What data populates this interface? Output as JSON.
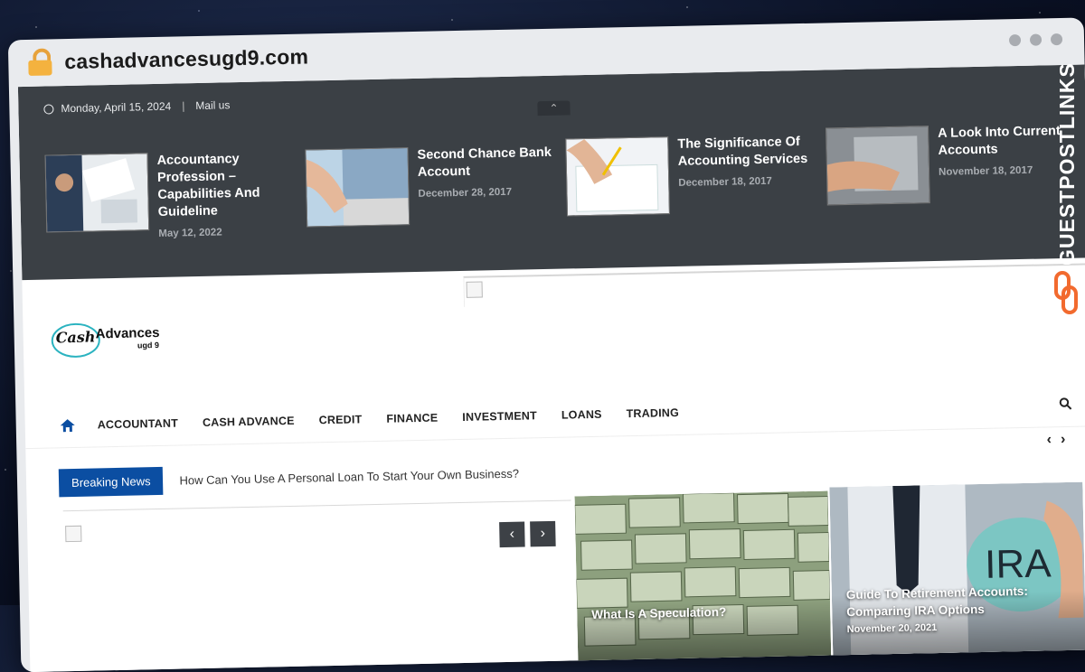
{
  "browser": {
    "url": "cashadvancesugd9.com"
  },
  "topbar": {
    "date": "Monday, April 15, 2024",
    "mail": "Mail us"
  },
  "top_slides": [
    {
      "title": "Accountancy Profession – Capabilities And Guideline",
      "date": "May 12, 2022"
    },
    {
      "title": "Second Chance Bank Account",
      "date": "December 28, 2017"
    },
    {
      "title": "The Significance Of Accounting Services",
      "date": "December 18, 2017"
    },
    {
      "title": "A Look Into Current Accounts",
      "date": "November 18, 2017"
    }
  ],
  "logo": {
    "main": "Cash Advances",
    "sub": "ugd 9"
  },
  "nav": {
    "items": [
      "ACCOUNTANT",
      "CASH ADVANCE",
      "CREDIT",
      "FINANCE",
      "INVESTMENT",
      "LOANS",
      "TRADING"
    ]
  },
  "breaking": {
    "label": "Breaking News",
    "headline": "How Can You Use A Personal Loan To Start Your Own Business?"
  },
  "cards": [
    {
      "title": "What Is A Speculation?",
      "date": ""
    },
    {
      "title": "Guide To Retirement Accounts: Comparing IRA Options",
      "date": "November 20, 2021"
    }
  ],
  "watermark": {
    "text": "GUESTPOSTLINKS"
  },
  "colors": {
    "topbar": "#3b4045",
    "accent": "#0b4ea2",
    "lock": "#f4b23f",
    "watermark_orange": "#f26a2e"
  }
}
